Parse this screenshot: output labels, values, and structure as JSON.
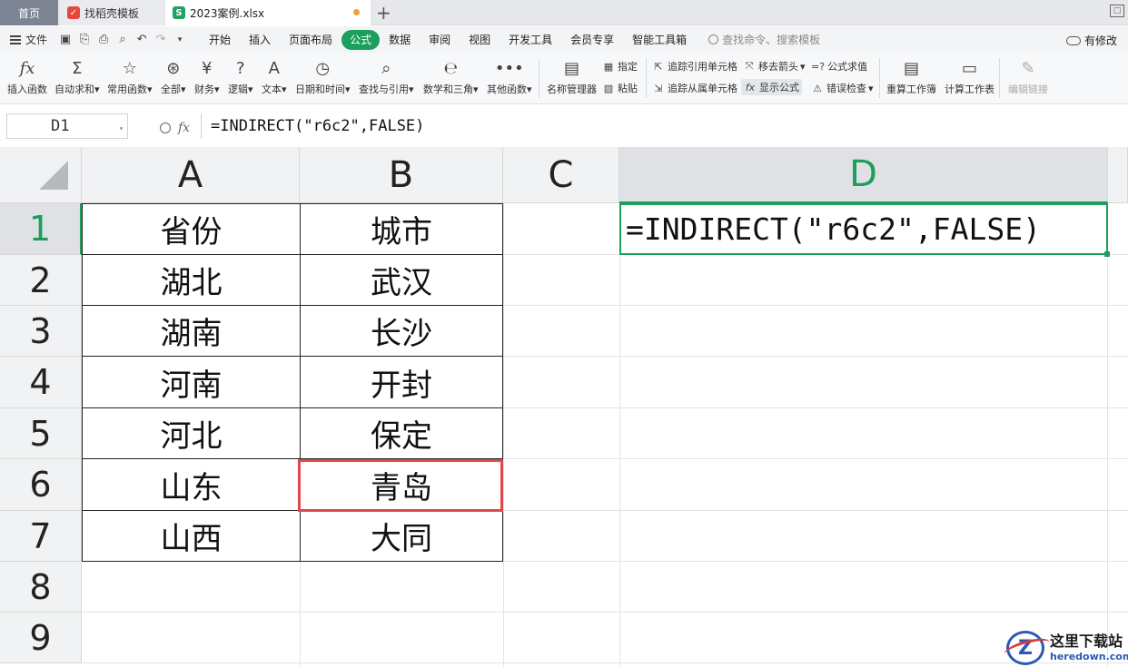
{
  "tabs": {
    "home": "首页",
    "template": "找稻壳模板",
    "file": "2023案例.xlsx",
    "file_icon_letter": "S"
  },
  "menu": {
    "file": "文件",
    "items": [
      "开始",
      "插入",
      "页面布局",
      "公式",
      "数据",
      "审阅",
      "视图",
      "开发工具",
      "会员专享",
      "智能工具箱"
    ],
    "active": "公式",
    "search": "查找命令、搜索模板",
    "changes": "有修改"
  },
  "ribbon": {
    "insert_function": "插入函数",
    "autosum": "自动求和",
    "common": "常用函数",
    "all": "全部",
    "finance": "财务",
    "logic": "逻辑",
    "text": "文本",
    "datetime": "日期和时间",
    "lookup": "查找与引用",
    "math": "数学和三角",
    "other": "其他函数",
    "name_manager": "名称管理器",
    "assign": "指定",
    "paste": "粘贴",
    "trace_precedents": "追踪引用单元格",
    "trace_dependents": "追踪从属单元格",
    "remove_arrows": "移去箭头",
    "show_formulas": "显示公式",
    "evaluate": "公式求值",
    "error_check": "错误检查",
    "recalc_book": "重算工作簿",
    "calc_sheet": "计算工作表",
    "edit_links": "编辑链接"
  },
  "formula_bar": {
    "name_box": "D1",
    "fx": "fx",
    "formula": "=INDIRECT(\"r6c2\",FALSE)"
  },
  "sheet": {
    "columns": [
      "A",
      "B",
      "C",
      "D"
    ],
    "rows": [
      "1",
      "2",
      "3",
      "4",
      "5",
      "6",
      "7",
      "8",
      "9"
    ],
    "colA": [
      "省份",
      "湖北",
      "湖南",
      "河南",
      "河北",
      "山东",
      "山西"
    ],
    "colB": [
      "城市",
      "武汉",
      "长沙",
      "开封",
      "保定",
      "青岛",
      "大同"
    ],
    "d1": "=INDIRECT(\"r6c2\",FALSE)",
    "selected_cell": "D1",
    "highlighted_cell": "B6",
    "accent": "#1c9e5c",
    "highlight_color": "#e0484c"
  },
  "watermark": {
    "letter": "Z",
    "cn": "这里下载站",
    "en": "heredown.com"
  }
}
